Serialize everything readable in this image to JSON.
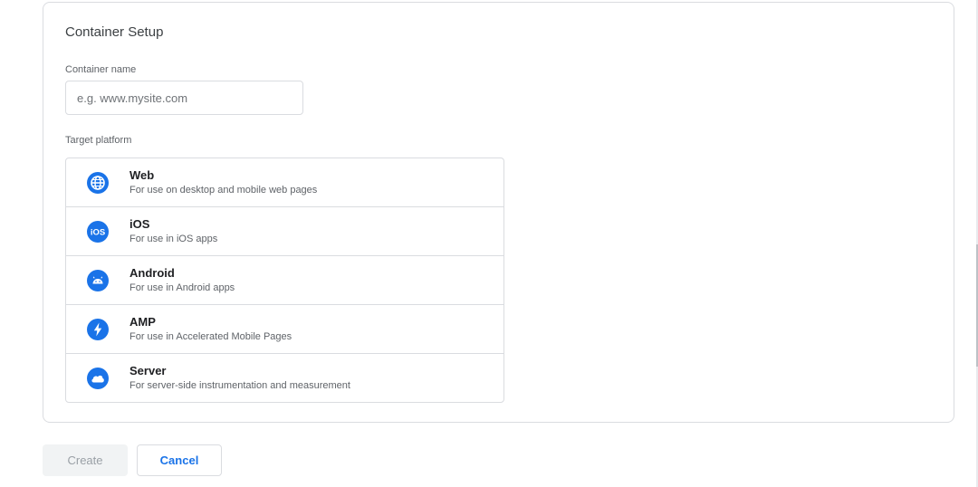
{
  "setup": {
    "title": "Container Setup",
    "name_label": "Container name",
    "name_value": "",
    "name_placeholder": "e.g. www.mysite.com",
    "platform_label": "Target platform"
  },
  "platforms": [
    {
      "name": "Web",
      "desc": "For use on desktop and mobile web pages",
      "icon": "globe-icon"
    },
    {
      "name": "iOS",
      "desc": "For use in iOS apps",
      "icon": "ios-icon"
    },
    {
      "name": "Android",
      "desc": "For use in Android apps",
      "icon": "android-icon"
    },
    {
      "name": "AMP",
      "desc": "For use in Accelerated Mobile Pages",
      "icon": "amp-bolt-icon"
    },
    {
      "name": "Server",
      "desc": "For server-side instrumentation and measurement",
      "icon": "cloud-icon"
    }
  ],
  "buttons": {
    "create_label": "Create",
    "cancel_label": "Cancel"
  },
  "colors": {
    "accent": "#1a73e8",
    "border": "#dadce0",
    "muted_text": "#5f6368",
    "disabled_bg": "#f1f3f4"
  }
}
